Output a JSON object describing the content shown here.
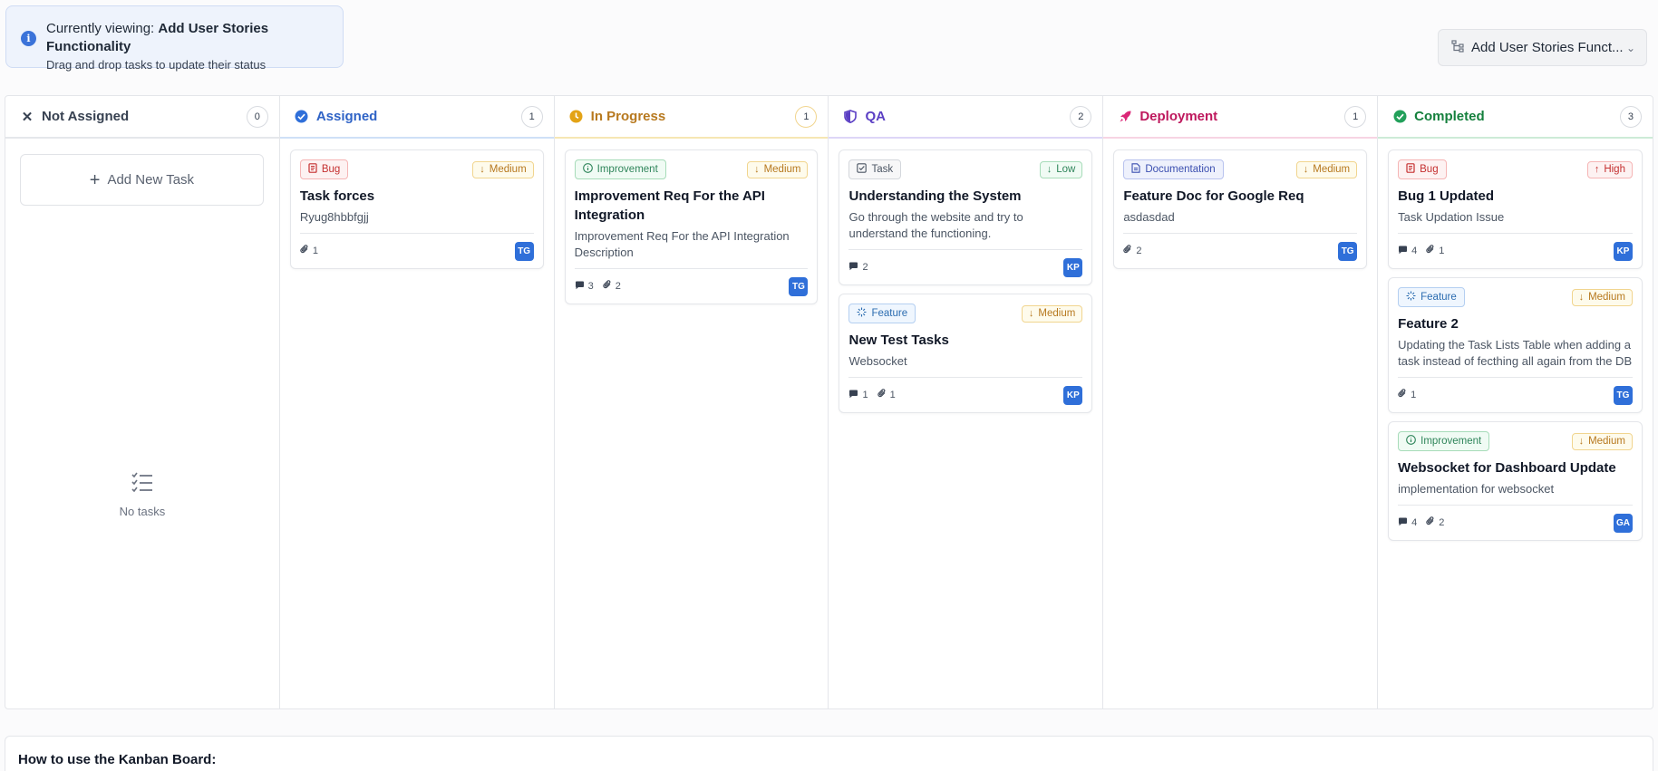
{
  "banner": {
    "prefix": "Currently viewing: ",
    "project": "Add User Stories Functionality",
    "hint": "Drag and drop tasks to update their status"
  },
  "project_selector": {
    "label": "Add User Stories Funct..."
  },
  "columns": [
    {
      "title": "Not Assigned",
      "count": "0",
      "color": "#374151"
    },
    {
      "title": "Assigned",
      "count": "1",
      "color": "#2f63c6"
    },
    {
      "title": "In Progress",
      "count": "1",
      "color": "#b7791f"
    },
    {
      "title": "QA",
      "count": "2",
      "color": "#5b3fc4"
    },
    {
      "title": "Deployment",
      "count": "1",
      "color": "#be185d"
    },
    {
      "title": "Completed",
      "count": "3",
      "color": "#15803d"
    }
  ],
  "not_assigned": {
    "add_label": "Add New Task",
    "empty_label": "No tasks"
  },
  "cards": {
    "assigned": [
      {
        "type": "Bug",
        "priority": "Medium",
        "title": "Task forces",
        "desc": "Ryug8hbbfgjj",
        "comments": "",
        "attachments": "1",
        "avatar": "TG"
      }
    ],
    "in_progress": [
      {
        "type": "Improvement",
        "priority": "Medium",
        "title": "Improvement Req For the API Integration",
        "desc": "Improvement Req For the API Integration Description",
        "comments": "3",
        "attachments": "2",
        "avatar": "TG"
      }
    ],
    "qa": [
      {
        "type": "Task",
        "priority": "Low",
        "title": "Understanding the System",
        "desc": "Go through the website and try to understand the functioning.",
        "comments": "2",
        "attachments": "",
        "avatar": "KP"
      },
      {
        "type": "Feature",
        "priority": "Medium",
        "title": "New Test Tasks",
        "desc": "Websocket",
        "comments": "1",
        "attachments": "1",
        "avatar": "KP"
      }
    ],
    "deployment": [
      {
        "type": "Documentation",
        "priority": "Medium",
        "title": "Feature Doc for Google Req",
        "desc": "asdasdad",
        "comments": "",
        "attachments": "2",
        "avatar": "TG"
      }
    ],
    "completed": [
      {
        "type": "Bug",
        "priority": "High",
        "title": "Bug 1 Updated",
        "desc": "Task Updation Issue",
        "comments": "4",
        "attachments": "1",
        "avatar": "KP"
      },
      {
        "type": "Feature",
        "priority": "Medium",
        "title": "Feature 2",
        "desc": "Updating the Task Lists Table when adding a task instead of fecthing all again from the DB",
        "comments": "",
        "attachments": "1",
        "avatar": "TG"
      },
      {
        "type": "Improvement",
        "priority": "Medium",
        "title": "Websocket for Dashboard Update",
        "desc": "implementation for websocket",
        "comments": "4",
        "attachments": "2",
        "avatar": "GA"
      }
    ]
  },
  "type_styles": {
    "Bug": {
      "icon": "bug-report-icon",
      "fg": "#c53030",
      "bg": "#fdf2f2",
      "border": "#f5b5b5"
    },
    "Improvement": {
      "icon": "info-circle-icon",
      "fg": "#2f855a",
      "bg": "#f0fbf4",
      "border": "#a7dcb9"
    },
    "Task": {
      "icon": "checkbox-icon",
      "fg": "#4b5563",
      "bg": "#f7f7f8",
      "border": "#d4d7dc"
    },
    "Feature": {
      "icon": "spark-icon",
      "fg": "#2b6cb0",
      "bg": "#eff6fe",
      "border": "#b4cff1"
    },
    "Documentation": {
      "icon": "document-icon",
      "fg": "#3b4fb0",
      "bg": "#eef1fc",
      "border": "#b9c3ee"
    }
  },
  "priority_styles": {
    "Medium": {
      "icon": "arrow-down-icon",
      "fg": "#b7791f",
      "bg": "#fefbec",
      "border": "#f1d58f"
    },
    "Low": {
      "icon": "arrow-down-icon",
      "fg": "#2f855a",
      "bg": "#f0fbf4",
      "border": "#a7dcb9"
    },
    "High": {
      "icon": "arrow-up-icon",
      "fg": "#c53030",
      "bg": "#fdf2f2",
      "border": "#f5b5b5"
    }
  },
  "help": {
    "title": "How to use the Kanban Board:"
  }
}
